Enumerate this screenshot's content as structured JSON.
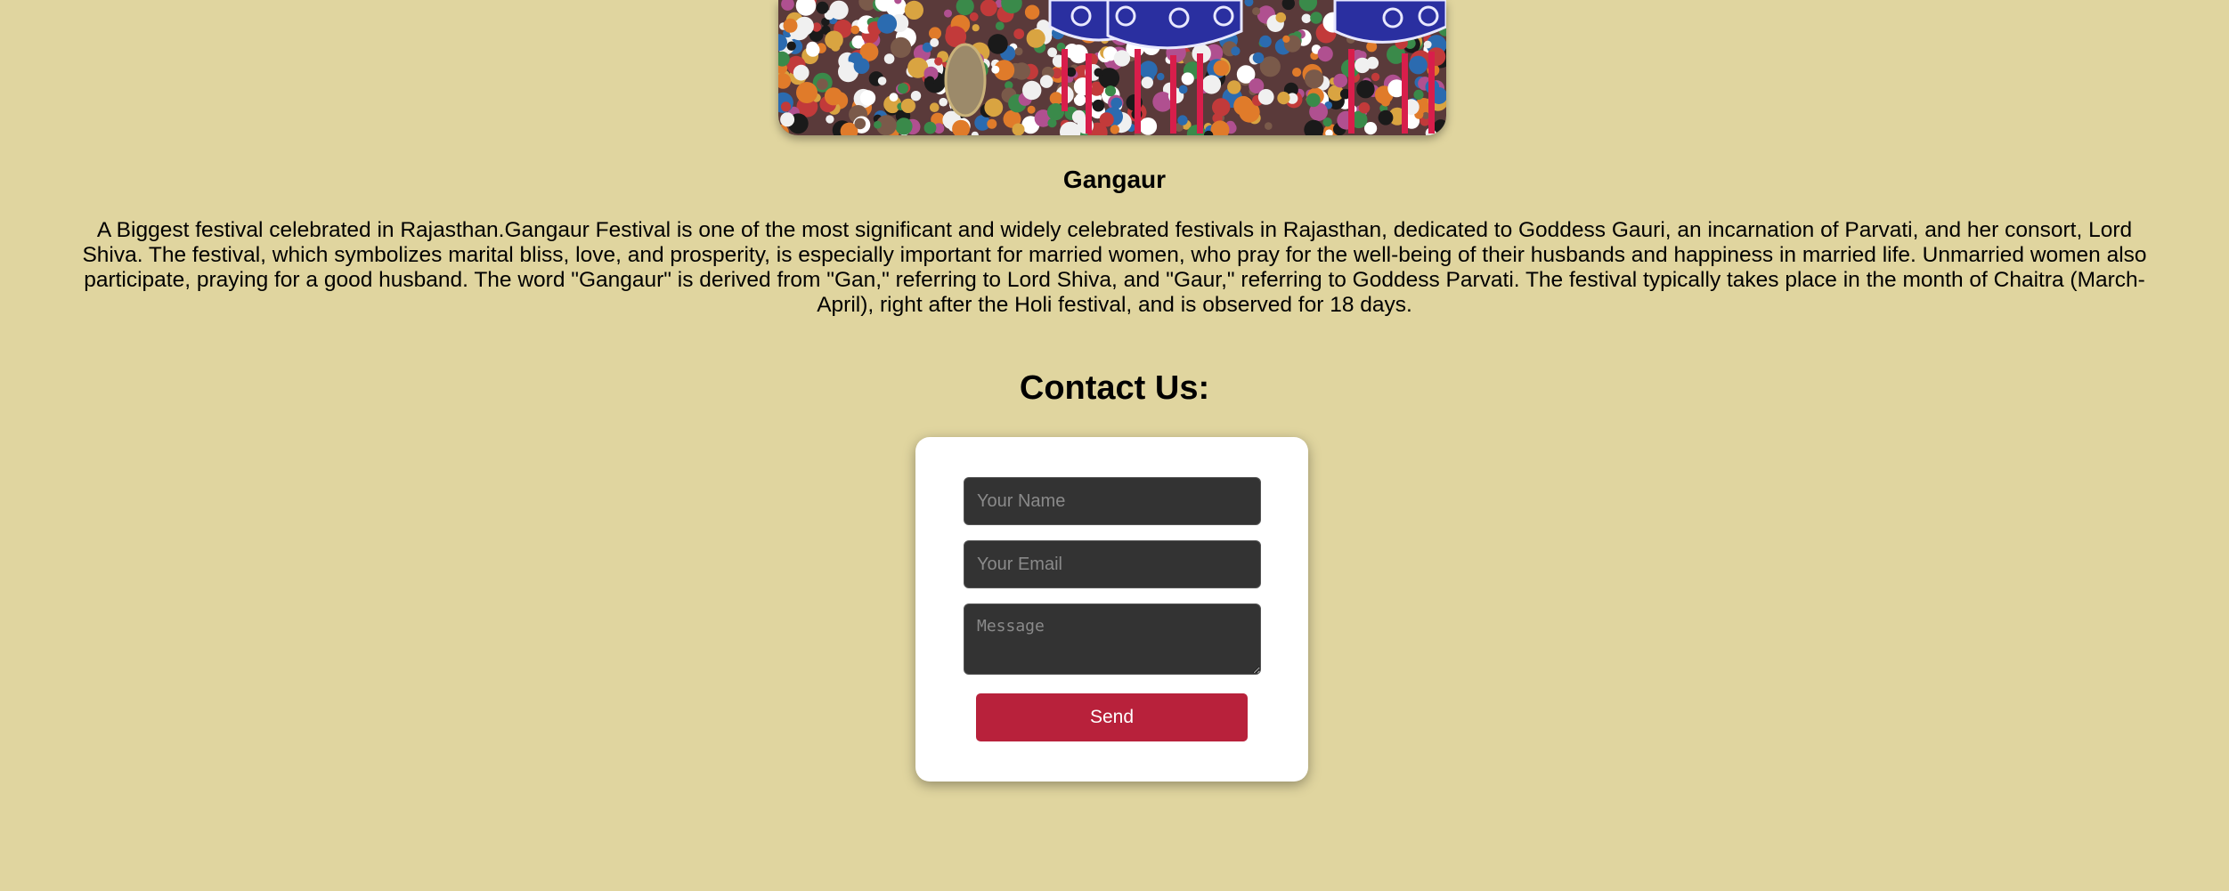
{
  "festival": {
    "title": "Gangaur",
    "description": "A Biggest festival celebrated in Rajasthan.Gangaur Festival is one of the most significant and widely celebrated festivals in Rajasthan, dedicated to Goddess Gauri, an incarnation of Parvati, and her consort, Lord Shiva. The festival, which symbolizes marital bliss, love, and prosperity, is especially important for married women, who pray for the well-being of their husbands and happiness in married life. Unmarried women also participate, praying for a good husband. The word \"Gangaur\" is derived from \"Gan,\" referring to Lord Shiva, and \"Gaur,\" referring to Goddess Parvati. The festival typically takes place in the month of Chaitra (March-April), right after the Holi festival, and is observed for 18 days."
  },
  "contact": {
    "heading": "Contact Us:",
    "name_placeholder": "Your Name",
    "name_value": "",
    "email_placeholder": "Your Email",
    "email_value": "",
    "message_placeholder": "Message",
    "message_value": "",
    "send_label": "Send"
  },
  "colors": {
    "page_background": "#e0d59f",
    "card_background": "#ffffff",
    "field_background": "#333333",
    "send_button": "#b8213b"
  }
}
